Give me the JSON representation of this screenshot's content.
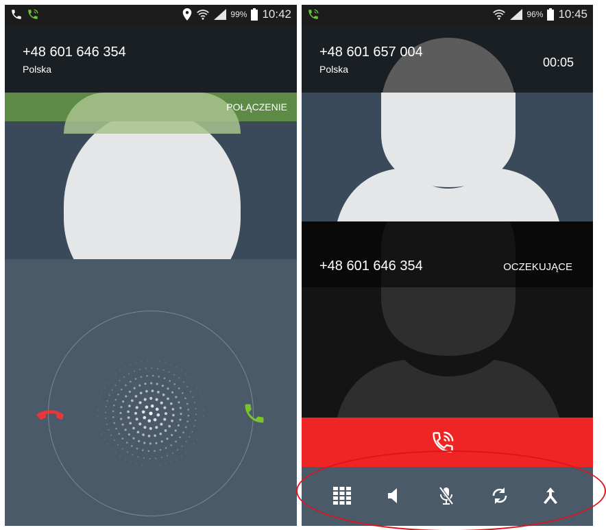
{
  "left_phone": {
    "status": {
      "battery_pct": "99%",
      "time": "10:42"
    },
    "caller": {
      "number": "+48 601 646 354",
      "country": "Polska"
    },
    "state_label": "POŁĄCZENIE"
  },
  "right_phone": {
    "status": {
      "battery_pct": "96%",
      "time": "10:45"
    },
    "active_call": {
      "number": "+48 601 657 004",
      "country": "Polska",
      "duration": "00:05"
    },
    "held_call": {
      "number": "+48 601 646 354",
      "state_label": "OCZEKUJĄCE"
    },
    "toolbar_icons": [
      "keypad-icon",
      "speaker-icon",
      "mute-icon",
      "swap-icon",
      "merge-icon"
    ]
  },
  "colors": {
    "accent_green": "#5d8a44",
    "end_red": "#ef2424",
    "answer_green": "#7cc22c",
    "decline_red": "#e8373a",
    "annotation_red": "#e2121a"
  }
}
